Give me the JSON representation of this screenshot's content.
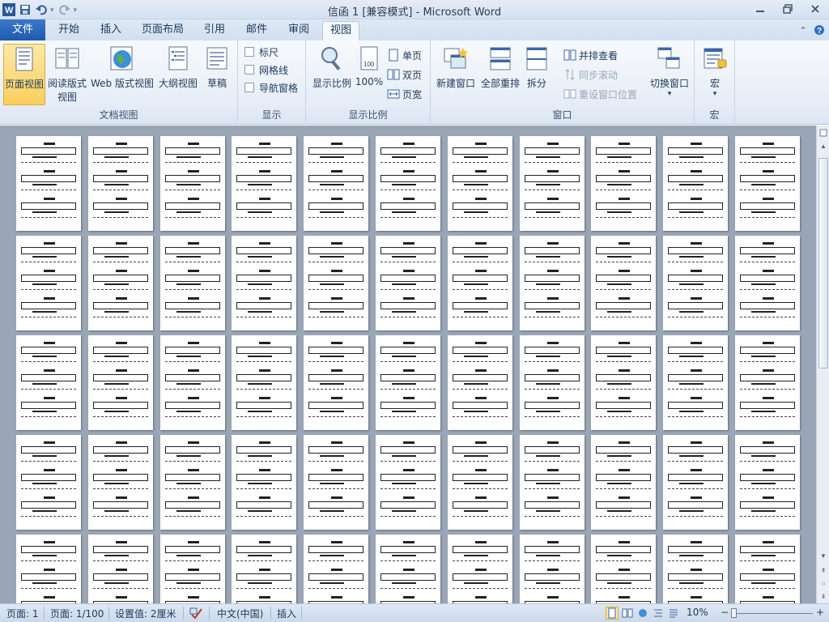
{
  "window": {
    "title": "信函 1 [兼容模式] - Microsoft Word",
    "app_icon_letter": "W",
    "minimize_icon": "minimize-icon",
    "restore_icon": "restore-icon",
    "close_icon": "close-icon"
  },
  "tabs": [
    {
      "label": "文件"
    },
    {
      "label": "开始"
    },
    {
      "label": "插入"
    },
    {
      "label": "页面布局"
    },
    {
      "label": "引用"
    },
    {
      "label": "邮件"
    },
    {
      "label": "审阅"
    },
    {
      "label": "视图"
    }
  ],
  "ribbon": {
    "doc_views": {
      "label": "文档视图",
      "print_layout": "页面视图",
      "full_reading_1": "阅读版式",
      "full_reading_2": "视图",
      "web_layout": "Web 版式视图",
      "outline": "大纲视图",
      "draft": "草稿"
    },
    "show": {
      "label": "显示",
      "ruler": "标尺",
      "gridlines": "网格线",
      "nav_pane": "导航窗格"
    },
    "zoom": {
      "label": "显示比例",
      "zoom": "显示比例",
      "hundred": "100%",
      "one_page": "单页",
      "two_pages": "双页",
      "page_width": "页宽"
    },
    "window": {
      "label": "窗口",
      "new_window": "新建窗口",
      "arrange_all": "全部重排",
      "split": "拆分",
      "side_by_side": "并排查看",
      "sync_scroll": "同步滚动",
      "reset_position": "重设窗口位置",
      "switch_windows": "切换窗口"
    },
    "macros": {
      "label": "宏",
      "macros": "宏"
    }
  },
  "statusbar": {
    "page": "页面: 1",
    "pages": "页面: 1/100",
    "setting": "设置值: 2厘米",
    "language": "中文(中国)",
    "insert_mode": "插入",
    "zoom_level": "10%",
    "zoom_minus": "−",
    "zoom_plus": "+"
  },
  "colors": {
    "file_tab": "#2b67bb",
    "active_button": "#f9cf5b",
    "doc_background": "#9aa6b6"
  }
}
